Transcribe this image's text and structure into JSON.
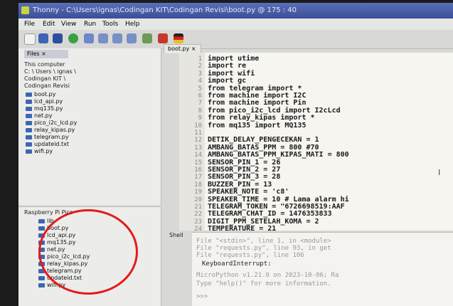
{
  "window": {
    "title": "Thonny - C:\\Users\\ignas\\Codingan KIT\\Codingan Revisi\\boot.py @ 175 : 40"
  },
  "menu": [
    "File",
    "Edit",
    "View",
    "Run",
    "Tools",
    "Help"
  ],
  "files_panel": {
    "tab": "Files ×",
    "section": "This computer",
    "path": "C: \\ Users \\ ignas \\",
    "path2": "Codingan KIT \\",
    "path3": "Codingan Revisi",
    "items": [
      "boot.py",
      "lcd_api.py",
      "mq135.py",
      "net.py",
      "pico_i2c_lcd.py",
      "relay_kipas.py",
      "telegram.py",
      "updateid.txt",
      "wifi.py"
    ]
  },
  "device_panel": {
    "title": "Raspberry Pi Pico",
    "items": [
      "lib",
      "boot.py",
      "lcd_api.py",
      "mq135.py",
      "net.py",
      "pico_i2c_lcd.py",
      "relay_kipas.py",
      "telegram.py",
      "updateid.txt",
      "wifi.py"
    ]
  },
  "editor": {
    "tab": "boot.py ×",
    "line_numbers": [
      "1",
      "2",
      "3",
      "4",
      "5",
      "6",
      "7",
      "8",
      "9",
      "10",
      "11",
      "12",
      "13",
      "14",
      "15",
      "16",
      "17",
      "18",
      "19",
      "20",
      "21",
      "22",
      "23",
      "24"
    ],
    "lines": [
      "import utime",
      "import re",
      "import wifi",
      "import gc",
      "from telegram import *",
      "from machine import I2C",
      "from machine import Pin",
      "from pico_i2c_lcd import I2cLcd",
      "from relay_kipas import *",
      "from mq135 import MQ135",
      "",
      "DETIK_DELAY_PENGECEKAN = 1",
      "AMBANG_BATAS_PPM = 800 #70",
      "AMBANG_BATAS_PPM_KIPAS_MATI = 800",
      "SENSOR_PIN_1 = 26",
      "SENSOR_PIN_2 = 27",
      "SENSOR_PIN_3 = 28",
      "BUZZER_PIN = 13",
      "SPEAKER_NOTE = 'c8'",
      "SPEAKER_TIME = 10 # Lama alarm hi",
      "TELEGRAM_TOKEN = \"6726698519:AAF",
      "TELEGRAM_CHAT_ID = 1476353833",
      "DIGIT_PPM_SETELAH_KOMA = 2",
      "TEMPERATURE = 21"
    ]
  },
  "shell": {
    "label": "Shell",
    "lines": [
      "File \"<stdin>\", line 1, in <module>",
      "File \"requests.py\", line 93, in get",
      "File \"requests.py\", line 106",
      "KeyboardInterrupt:",
      "MicroPython v1.21.0 on 2023-10-06; Ra",
      "Type \"help()\" for more information.",
      ">>>"
    ]
  },
  "colors": {
    "title_bar": "#3b4f98",
    "highlight_circle": "#e21b1b"
  }
}
